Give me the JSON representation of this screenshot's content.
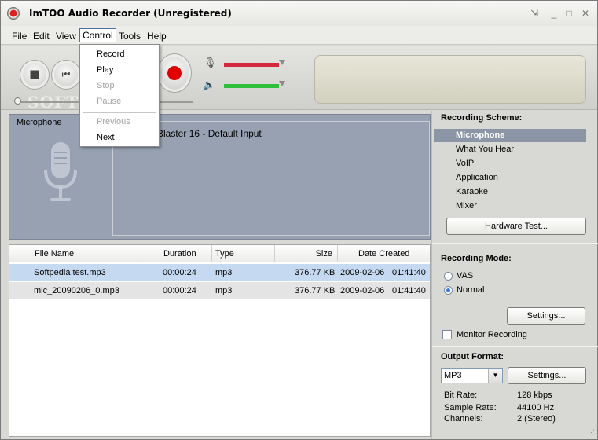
{
  "window": {
    "title": "ImTOO Audio Recorder (Unregistered)"
  },
  "menubar": {
    "items": [
      "File",
      "Edit",
      "View",
      "Control",
      "Tools",
      "Help"
    ]
  },
  "control_menu": {
    "items": [
      {
        "label": "Record",
        "enabled": true
      },
      {
        "label": "Play",
        "enabled": true
      },
      {
        "label": "Stop",
        "enabled": false
      },
      {
        "label": "Pause",
        "enabled": false
      },
      {
        "label": "Previous",
        "enabled": false
      },
      {
        "label": "Next",
        "enabled": true
      }
    ]
  },
  "toolbar": {
    "watermark": "SOFTPEDIA",
    "mic_volume": 0.95,
    "speaker_volume": 0.95,
    "mic_level_color": "#d4283c",
    "speaker_level_color": "#2fbf3a",
    "record_color": "#e00000"
  },
  "source": {
    "label": "Microphone",
    "device": "d Blaster 16 - Default Input"
  },
  "file_table": {
    "columns": [
      "File Name",
      "Duration",
      "Type",
      "Size",
      "Date Created"
    ],
    "rows": [
      {
        "name": "Softpedia test.mp3",
        "duration": "00:00:24",
        "type": "mp3",
        "size": "376.77 KB",
        "date": "2009-02-06",
        "time": "01:41:40",
        "selected": true
      },
      {
        "name": "mic_20090206_0.mp3",
        "duration": "00:00:24",
        "type": "mp3",
        "size": "376.77 KB",
        "date": "2009-02-06",
        "time": "01:41:40",
        "selected": false
      }
    ]
  },
  "recording_scheme": {
    "title": "Recording Scheme:",
    "items": [
      "Microphone",
      "What You Hear",
      "VoIP",
      "Application",
      "Karaoke",
      "Mixer"
    ],
    "selected": "Microphone",
    "hardware_test_label": "Hardware Test..."
  },
  "recording_mode": {
    "title": "Recording Mode:",
    "options": [
      "VAS",
      "Normal"
    ],
    "selected": "Normal",
    "settings_label": "Settings...",
    "monitor_label": "Monitor Recording",
    "monitor_checked": false
  },
  "output_format": {
    "title": "Output Format:",
    "format": "MP3",
    "settings_label": "Settings...",
    "bit_rate_label": "Bit Rate:",
    "bit_rate": "128 kbps",
    "sample_rate_label": "Sample Rate:",
    "sample_rate": "44100 Hz",
    "channels_label": "Channels:",
    "channels": "2 (Stereo)"
  }
}
